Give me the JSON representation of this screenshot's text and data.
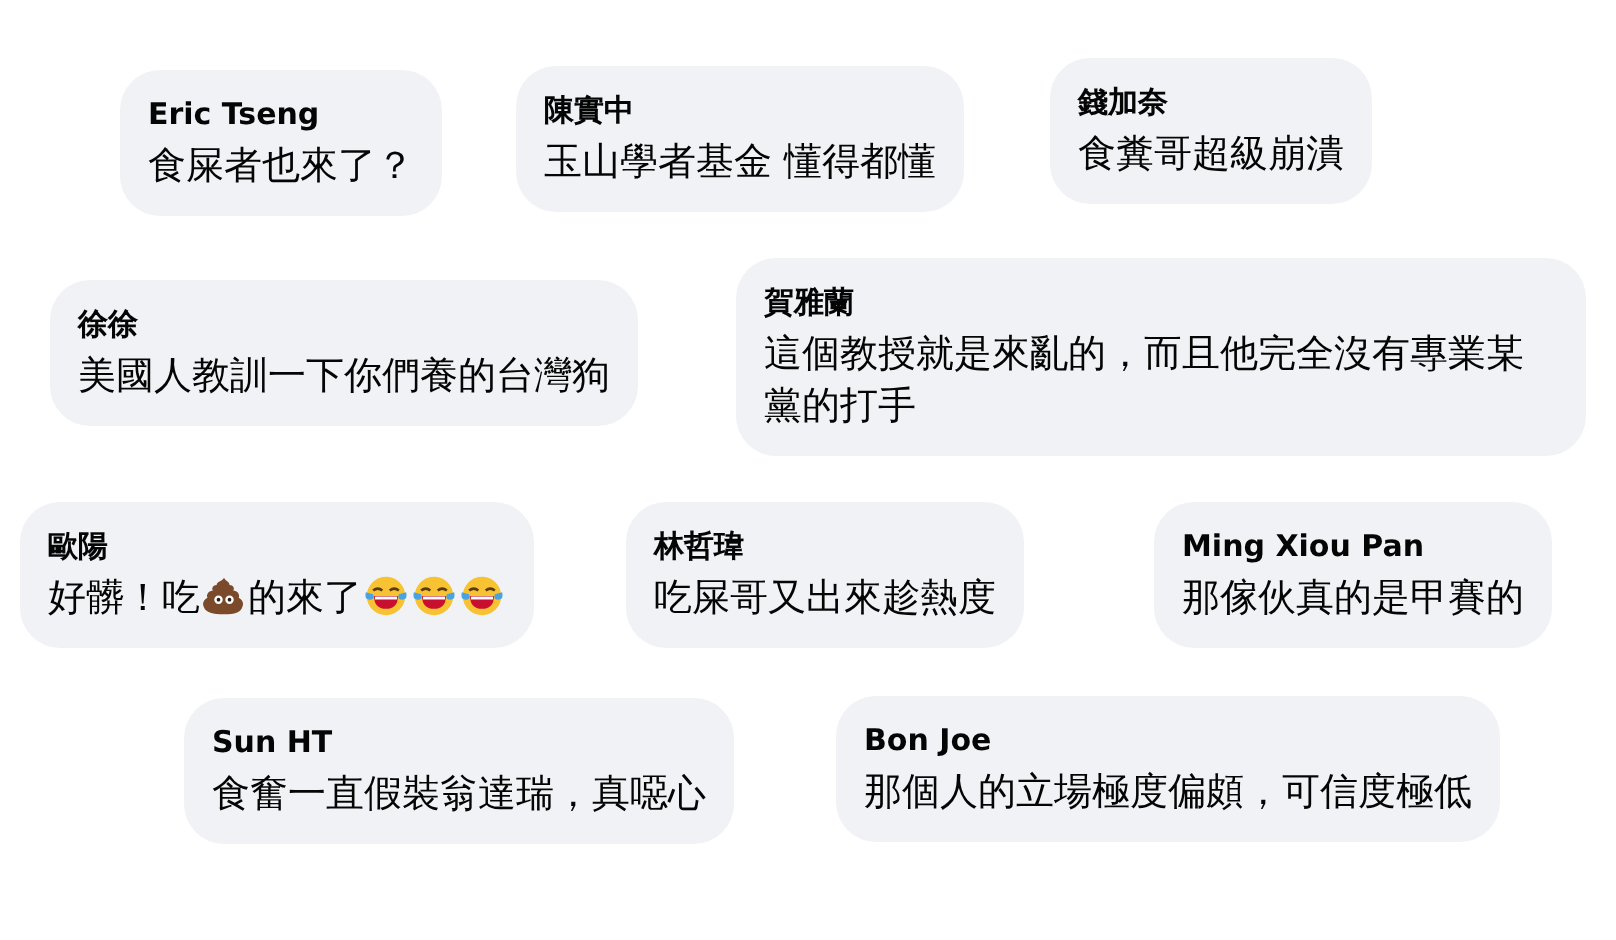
{
  "comments": [
    {
      "author": "Eric Tseng",
      "segments": [
        {
          "kind": "text",
          "text": "食屎者也來了？"
        }
      ]
    },
    {
      "author": "陳實中",
      "segments": [
        {
          "kind": "text",
          "text": "玉山學者基金 懂得都懂"
        }
      ]
    },
    {
      "author": "錢加奈",
      "segments": [
        {
          "kind": "text",
          "text": "食糞哥超級崩潰"
        }
      ]
    },
    {
      "author": "徐徐",
      "segments": [
        {
          "kind": "text",
          "text": "美國人教訓一下你們養的台灣狗"
        }
      ]
    },
    {
      "author": "賀雅蘭",
      "segments": [
        {
          "kind": "text",
          "text": "這個教授就是來亂的，而且他完全沒有專業某黨的打手"
        }
      ]
    },
    {
      "author": "歐陽",
      "segments": [
        {
          "kind": "text",
          "text": "好髒！吃"
        },
        {
          "kind": "poop"
        },
        {
          "kind": "text",
          "text": "的來了"
        },
        {
          "kind": "laugh"
        },
        {
          "kind": "laugh"
        },
        {
          "kind": "laugh"
        }
      ]
    },
    {
      "author": "林哲瑋",
      "segments": [
        {
          "kind": "text",
          "text": "吃屎哥又出來趁熱度"
        }
      ]
    },
    {
      "author": "Ming Xiou Pan",
      "segments": [
        {
          "kind": "text",
          "text": "那傢伙真的是甲賽的"
        }
      ]
    },
    {
      "author": "Sun HT",
      "segments": [
        {
          "kind": "text",
          "text": "食奮一直假裝翁達瑞，真噁心"
        }
      ]
    },
    {
      "author": "Bon Joe",
      "segments": [
        {
          "kind": "text",
          "text": "那個人的立場極度偏頗，可信度極低"
        }
      ]
    }
  ]
}
